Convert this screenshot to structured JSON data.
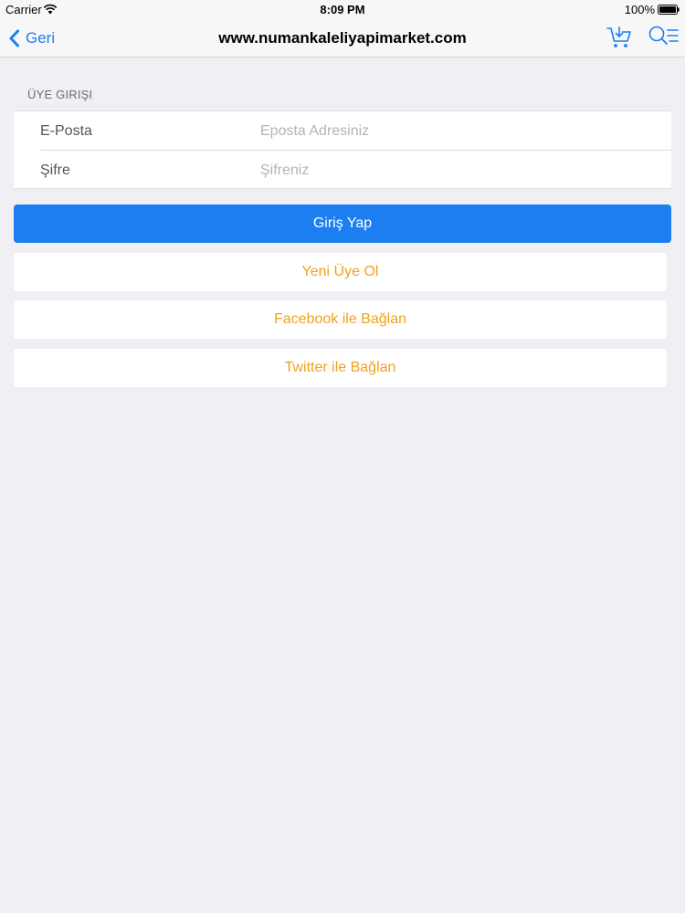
{
  "status_bar": {
    "carrier": "Carrier",
    "time": "8:09 PM",
    "battery": "100%",
    "icons": [
      "wifi-icon",
      "battery-icon"
    ]
  },
  "nav_bar": {
    "back_label": "Geri",
    "title": "www.numankaleliyapimarket.com",
    "icons": [
      "chevron-left-icon",
      "cart-icon",
      "search-menu-icon"
    ]
  },
  "login_section": {
    "header": "ÜYE GIRIŞI",
    "fields": [
      {
        "label": "E-Posta",
        "placeholder": "Eposta Adresiniz",
        "value": ""
      },
      {
        "label": "Şifre",
        "placeholder": "Şifreniz",
        "value": ""
      }
    ]
  },
  "buttons": {
    "login": "Giriş Yap",
    "register": "Yeni Üye Ol",
    "facebook": "Facebook ile Bağlan",
    "twitter": "Twitter ile Bağlan"
  },
  "colors": {
    "accent": "#1b7ff2",
    "secondary_text": "#f0a21a",
    "background": "#efeff4"
  }
}
